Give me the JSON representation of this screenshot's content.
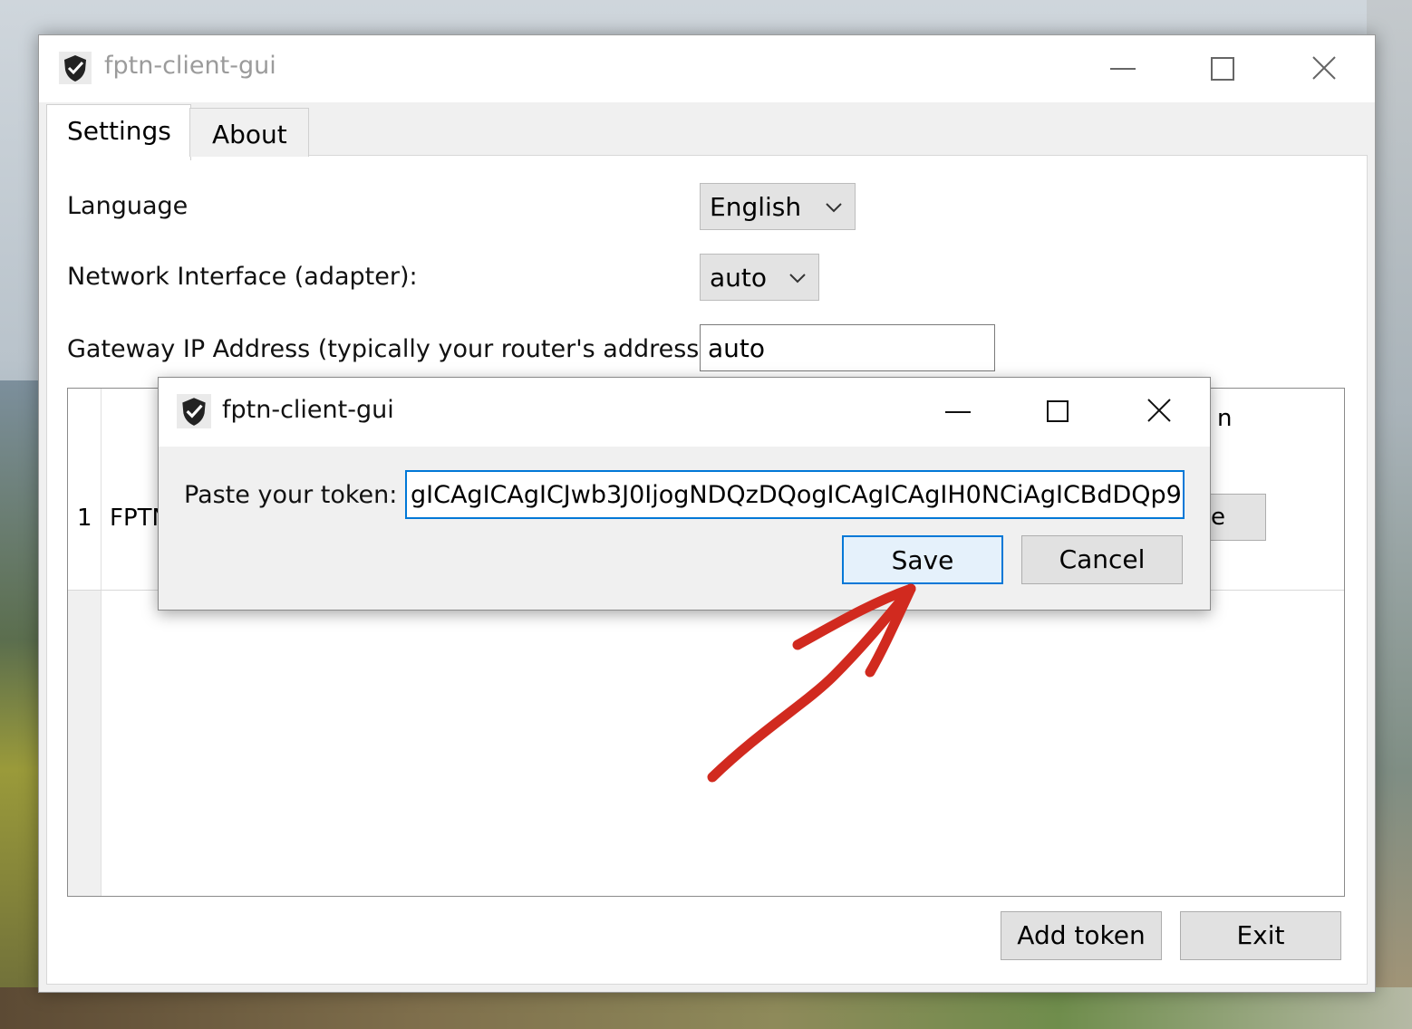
{
  "window": {
    "title": "fptn-client-gui",
    "controls": {
      "minimize": "minimize-icon",
      "maximize": "maximize-icon",
      "close": "close-icon"
    }
  },
  "tabs": [
    {
      "label": "Settings",
      "active": true
    },
    {
      "label": "About",
      "active": false
    }
  ],
  "settings": {
    "language_label": "Language",
    "language_value": "English",
    "interface_label": "Network Interface (adapter):",
    "interface_value": "auto",
    "gateway_label": "Gateway IP Address (typically your router's address):",
    "gateway_value": "auto"
  },
  "table": {
    "header_partial": "n",
    "rows": [
      {
        "num": "1",
        "name": "FPTN",
        "button_partial": "e"
      }
    ]
  },
  "footer": {
    "add_token": "Add token",
    "exit": "Exit"
  },
  "dialog": {
    "title": "fptn-client-gui",
    "token_label": "Paste your token:",
    "token_value": "gICAgICAgICJwb3J0IjogNDQzDQogICAgICAgIH0NCiAgICBdDQp9",
    "save": "Save",
    "cancel": "Cancel"
  },
  "annotation": {
    "arrow_color": "#d12a1f"
  },
  "colors": {
    "accent": "#0078d7"
  }
}
